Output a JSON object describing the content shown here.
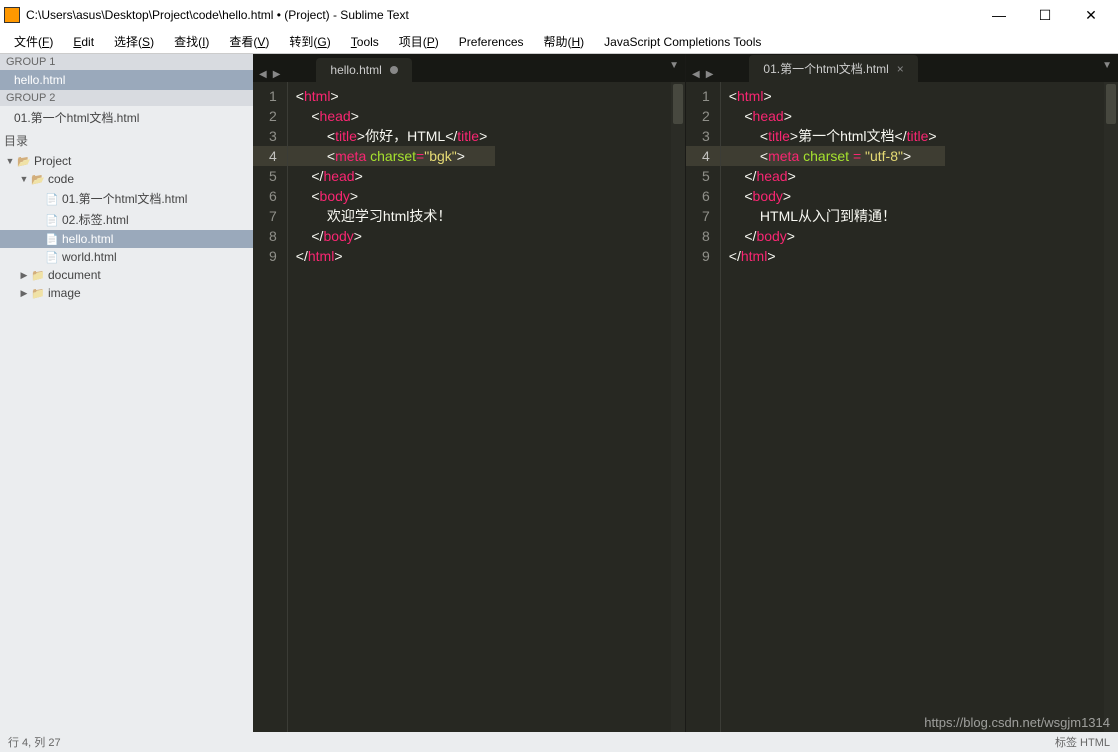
{
  "window": {
    "title": "C:\\Users\\asus\\Desktop\\Project\\code\\hello.html • (Project) - Sublime Text"
  },
  "menu": {
    "items": [
      {
        "label": "文件(F)",
        "u": "F"
      },
      {
        "label": "Edit",
        "u": "E"
      },
      {
        "label": "选择(S)",
        "u": "S"
      },
      {
        "label": "查找(I)",
        "u": "I"
      },
      {
        "label": "查看(V)",
        "u": "V"
      },
      {
        "label": "转到(G)",
        "u": "G"
      },
      {
        "label": "Tools",
        "u": "T"
      },
      {
        "label": "项目(P)",
        "u": "P"
      },
      {
        "label": "Preferences",
        "u": ""
      },
      {
        "label": "帮助(H)",
        "u": "H"
      },
      {
        "label": "JavaScript Completions Tools",
        "u": ""
      }
    ]
  },
  "sidebar": {
    "group1_label": "GROUP 1",
    "group1_files": [
      "hello.html"
    ],
    "group2_label": "GROUP 2",
    "group2_files": [
      "01.第一个html文档.html"
    ],
    "folders_label": "目录",
    "tree": {
      "project": "Project",
      "code": "code",
      "code_children": [
        "01.第一个html文档.html",
        "02.标签.html",
        "hello.html",
        "world.html"
      ],
      "document": "document",
      "image": "image"
    },
    "active_file": "hello.html"
  },
  "pane_left": {
    "tab_label": "hello.html",
    "dirty": true,
    "highlight_line": 4,
    "lines": [
      [
        {
          "c": "brk",
          "t": "<"
        },
        {
          "c": "tag",
          "t": "html"
        },
        {
          "c": "brk",
          "t": ">"
        }
      ],
      [
        {
          "c": "txt",
          "t": "    "
        },
        {
          "c": "brk",
          "t": "<"
        },
        {
          "c": "tag",
          "t": "head"
        },
        {
          "c": "brk",
          "t": ">"
        }
      ],
      [
        {
          "c": "txt",
          "t": "        "
        },
        {
          "c": "brk",
          "t": "<"
        },
        {
          "c": "tag",
          "t": "title"
        },
        {
          "c": "brk",
          "t": ">"
        },
        {
          "c": "txt",
          "t": "你好，HTML"
        },
        {
          "c": "brk",
          "t": "</"
        },
        {
          "c": "tag",
          "t": "title"
        },
        {
          "c": "brk",
          "t": ">"
        }
      ],
      [
        {
          "c": "txt",
          "t": "        "
        },
        {
          "c": "brk",
          "t": "<"
        },
        {
          "c": "tag",
          "t": "meta"
        },
        {
          "c": "txt",
          "t": " "
        },
        {
          "c": "attr",
          "t": "charset"
        },
        {
          "c": "op",
          "t": "="
        },
        {
          "c": "str",
          "t": "\"bgk\""
        },
        {
          "c": "brk",
          "t": ">"
        }
      ],
      [
        {
          "c": "txt",
          "t": "    "
        },
        {
          "c": "brk",
          "t": "</"
        },
        {
          "c": "tag",
          "t": "head"
        },
        {
          "c": "brk",
          "t": ">"
        }
      ],
      [
        {
          "c": "txt",
          "t": "    "
        },
        {
          "c": "brk",
          "t": "<"
        },
        {
          "c": "tag",
          "t": "body"
        },
        {
          "c": "brk",
          "t": ">"
        }
      ],
      [
        {
          "c": "txt",
          "t": "        欢迎学习html技术！"
        }
      ],
      [
        {
          "c": "txt",
          "t": "    "
        },
        {
          "c": "brk",
          "t": "</"
        },
        {
          "c": "tag",
          "t": "body"
        },
        {
          "c": "brk",
          "t": ">"
        }
      ],
      [
        {
          "c": "brk",
          "t": "</"
        },
        {
          "c": "tag",
          "t": "html"
        },
        {
          "c": "brk",
          "t": ">"
        }
      ]
    ]
  },
  "pane_right": {
    "tab_label": "01.第一个html文档.html",
    "dirty": false,
    "highlight_line": 4,
    "lines": [
      [
        {
          "c": "brk",
          "t": "<"
        },
        {
          "c": "tag",
          "t": "html"
        },
        {
          "c": "brk",
          "t": ">"
        }
      ],
      [
        {
          "c": "txt",
          "t": "    "
        },
        {
          "c": "brk",
          "t": "<"
        },
        {
          "c": "tag",
          "t": "head"
        },
        {
          "c": "brk",
          "t": ">"
        }
      ],
      [
        {
          "c": "txt",
          "t": "        "
        },
        {
          "c": "brk",
          "t": "<"
        },
        {
          "c": "tag",
          "t": "title"
        },
        {
          "c": "brk",
          "t": ">"
        },
        {
          "c": "txt",
          "t": "第一个html文档"
        },
        {
          "c": "brk",
          "t": "</"
        },
        {
          "c": "tag",
          "t": "title"
        },
        {
          "c": "brk",
          "t": ">"
        }
      ],
      [
        {
          "c": "txt",
          "t": "        "
        },
        {
          "c": "brk",
          "t": "<"
        },
        {
          "c": "tag",
          "t": "meta"
        },
        {
          "c": "txt",
          "t": " "
        },
        {
          "c": "attr",
          "t": "charset"
        },
        {
          "c": "txt",
          "t": " "
        },
        {
          "c": "op",
          "t": "="
        },
        {
          "c": "txt",
          "t": " "
        },
        {
          "c": "str",
          "t": "\"utf-8\""
        },
        {
          "c": "brk",
          "t": ">"
        }
      ],
      [
        {
          "c": "txt",
          "t": "    "
        },
        {
          "c": "brk",
          "t": "</"
        },
        {
          "c": "tag",
          "t": "head"
        },
        {
          "c": "brk",
          "t": ">"
        }
      ],
      [
        {
          "c": "txt",
          "t": "    "
        },
        {
          "c": "brk",
          "t": "<"
        },
        {
          "c": "tag",
          "t": "body"
        },
        {
          "c": "brk",
          "t": ">"
        }
      ],
      [
        {
          "c": "txt",
          "t": "        HTML从入门到精通！"
        }
      ],
      [
        {
          "c": "txt",
          "t": "    "
        },
        {
          "c": "brk",
          "t": "</"
        },
        {
          "c": "tag",
          "t": "body"
        },
        {
          "c": "brk",
          "t": ">"
        }
      ],
      [
        {
          "c": "brk",
          "t": "</"
        },
        {
          "c": "tag",
          "t": "html"
        },
        {
          "c": "brk",
          "t": ">"
        }
      ]
    ]
  },
  "statusbar": {
    "left": "行 4, 列 27",
    "right": "标签   HTML"
  },
  "watermark": "https://blog.csdn.net/wsgjm1314"
}
